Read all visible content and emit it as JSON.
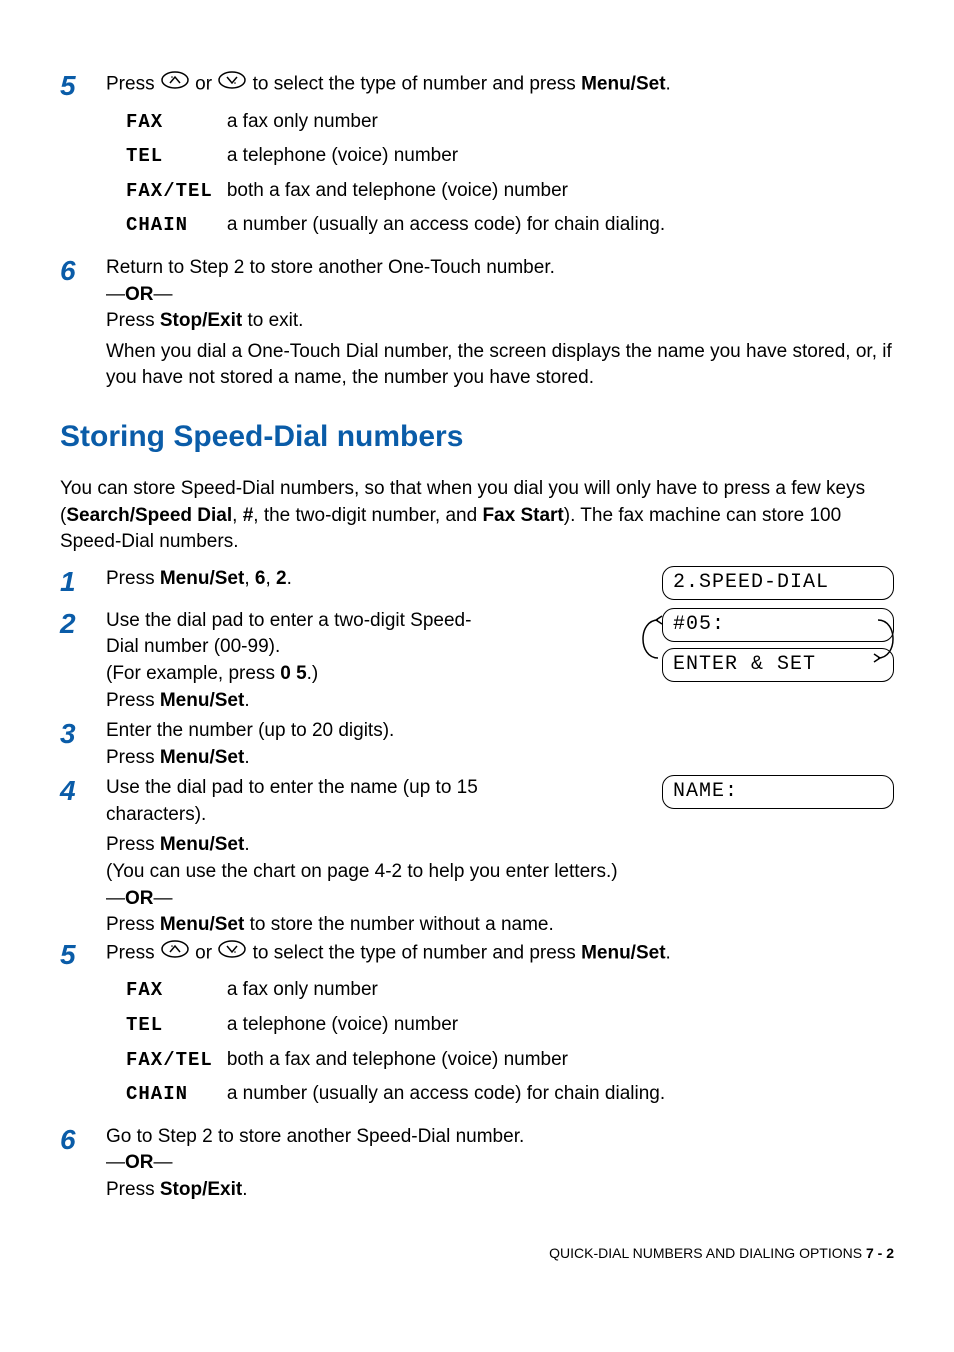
{
  "step5a": {
    "text_pre": "Press ",
    "text_mid": " or ",
    "text_post": " to select the type of number and press ",
    "menu_set": "Menu/Set",
    "period": "."
  },
  "type_table": [
    {
      "code": "FAX",
      "desc": "a fax only number"
    },
    {
      "code": "TEL",
      "desc": "a telephone (voice) number"
    },
    {
      "code": "FAX/TEL",
      "desc": "both a fax and telephone (voice) number"
    },
    {
      "code": "CHAIN",
      "desc": "a number (usually an access code) for chain dialing."
    }
  ],
  "step6a": {
    "line1": "Return to Step 2 to store another One-Touch number.",
    "or_dash": "—",
    "or": "OR",
    "line2_pre": "Press ",
    "stop_exit": "Stop/Exit",
    "line2_post": " to exit.",
    "line3": "When you dial a One-Touch Dial number, the screen displays the name you have stored, or, if you have not stored a name, the number you have stored."
  },
  "heading": "Storing Speed-Dial numbers",
  "intro": {
    "t1": "You can store Speed-Dial numbers, so that when you dial you will only have to press a few keys (",
    "b1": "Search/Speed Dial",
    "t2": ", ",
    "b2": "#",
    "t3": ", the two-digit number, and ",
    "b3": "Fax Start",
    "t4": "). The fax machine can store 100 Speed-Dial numbers."
  },
  "sd": {
    "step1": {
      "pre": "Press ",
      "menu_set": "Menu/Set",
      "c1": ", ",
      "k1": "6",
      "c2": ", ",
      "k2": "2",
      "post": "."
    },
    "lcd1": "2.SPEED-DIAL",
    "step2": {
      "line1": "Use the dial pad to enter a two-digit Speed-Dial number (00-99).",
      "ex_pre": "(For example, press ",
      "ex_keys": "0 5",
      "ex_post": ".)",
      "press_pre": "Press ",
      "menu_set": "Menu/Set",
      "period": "."
    },
    "lcd2a": "#05:",
    "lcd2b": "ENTER & SET",
    "step3": {
      "line1": "Enter the number (up to 20 digits).",
      "press_pre": "Press ",
      "menu_set": "Menu/Set",
      "period": "."
    },
    "step4": {
      "line1": "Use the dial pad to enter the name (up to 15 characters).",
      "press_pre": "Press ",
      "menu_set": "Menu/Set",
      "period": ".",
      "chart": "(You can use the chart on page 4-2 to help you enter letters.)",
      "or_dash": "—",
      "or": "OR",
      "alt_pre": "Press ",
      "alt_post": " to store the number without a name."
    },
    "lcd3": "NAME:",
    "step5": {
      "text_pre": "Press ",
      "text_mid": " or ",
      "text_post": " to select the type of number and press ",
      "menu_set": "Menu/Set",
      "period": "."
    },
    "step6": {
      "line1": "Go to Step 2 to store another Speed-Dial number.",
      "or_dash": "—",
      "or": "OR",
      "line2_pre": "Press ",
      "stop_exit": "Stop/Exit",
      "line2_post": "."
    }
  },
  "footer": {
    "text": "QUICK-DIAL NUMBERS AND DIALING OPTIONS   ",
    "page": "7 - 2"
  },
  "nums": {
    "n5": "5",
    "n6": "6",
    "n1": "1",
    "n2": "2",
    "n3": "3",
    "n4": "4"
  }
}
